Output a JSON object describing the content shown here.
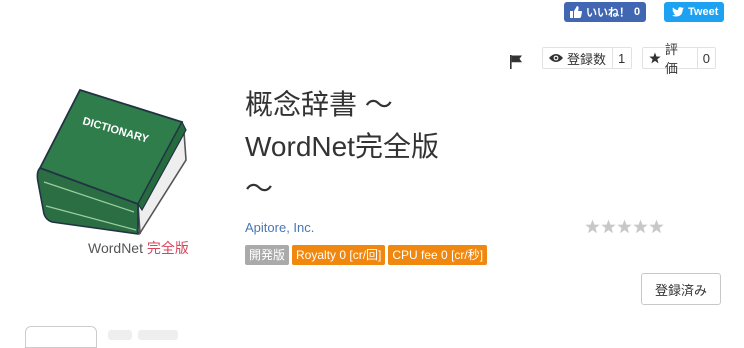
{
  "social": {
    "like_label": "いいね！",
    "like_count": "0",
    "tweet_label": "Tweet"
  },
  "stats": {
    "flag_icon": "flag-icon",
    "subscribers_label": "登録数",
    "subscribers_count": "1",
    "rating_label": "評価",
    "rating_count": "0"
  },
  "product": {
    "image_title_text": "DICTIONARY",
    "caption_main": "WordNet ",
    "caption_accent": "完全版",
    "title_line1": "概念辞書 ～",
    "title_line2": "WordNet完全版",
    "title_line3": "～",
    "company": "Apitore, Inc.",
    "stars": 0,
    "stars_max": 5
  },
  "badges": [
    {
      "label": "開発版",
      "style": "gray"
    },
    {
      "label": "Royalty 0 [cr/回]",
      "style": "orange"
    },
    {
      "label": "CPU fee 0 [cr/秒]",
      "style": "orange"
    }
  ],
  "actions": {
    "registered_label": "登録済み"
  },
  "colors": {
    "facebook": "#4267b2",
    "twitter": "#1da1f2",
    "badge_orange": "#f0870f",
    "badge_gray": "#aaaaaa",
    "link": "#4a77b4",
    "book_green": "#2e7d4a"
  }
}
